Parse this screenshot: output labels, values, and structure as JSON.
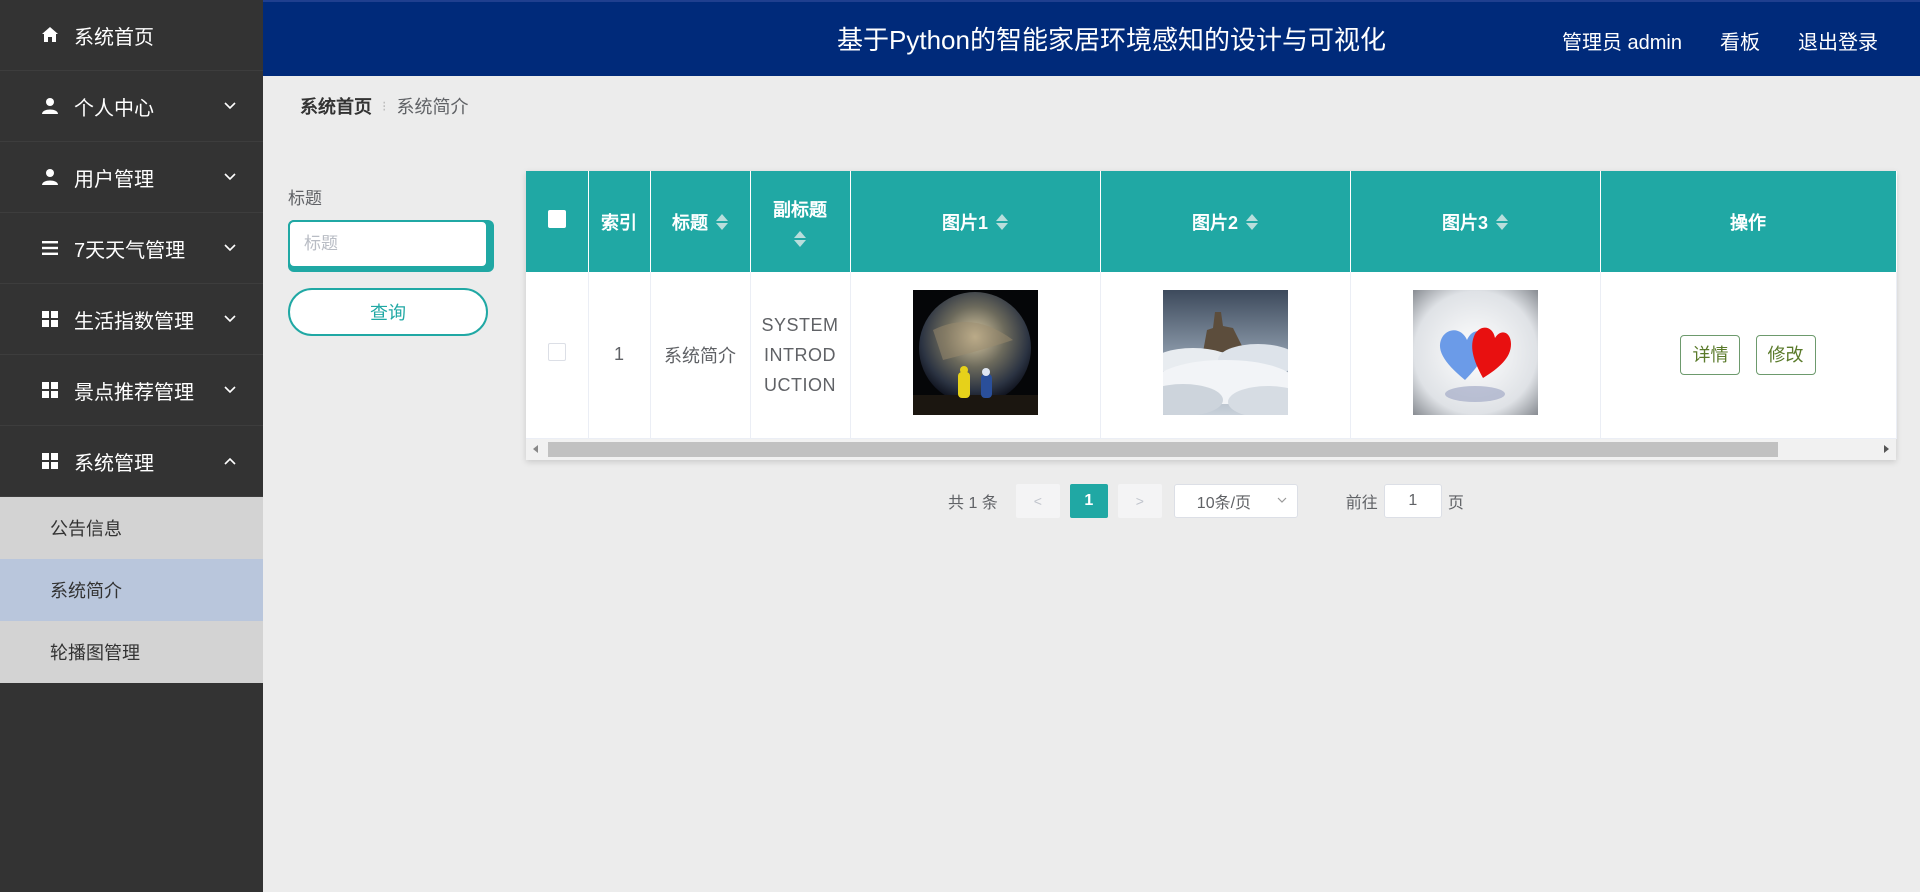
{
  "sidebar": {
    "items": [
      {
        "label": "系统首页",
        "icon": "home-icon"
      },
      {
        "label": "个人中心",
        "icon": "user-icon"
      },
      {
        "label": "用户管理",
        "icon": "user-icon"
      },
      {
        "label": "7天天气管理",
        "icon": "list-icon"
      },
      {
        "label": "生活指数管理",
        "icon": "grid-icon"
      },
      {
        "label": "景点推荐管理",
        "icon": "grid-icon"
      },
      {
        "label": "系统管理",
        "icon": "grid-icon"
      }
    ],
    "submenu": [
      {
        "label": "公告信息"
      },
      {
        "label": "系统简介"
      },
      {
        "label": "轮播图管理"
      }
    ]
  },
  "header": {
    "title": "基于Python的智能家居环境感知的设计与可视化",
    "user": "管理员 admin",
    "board": "看板",
    "logout": "退出登录"
  },
  "breadcrumb": {
    "home": "系统首页",
    "current": "系统简介"
  },
  "search": {
    "label": "标题",
    "placeholder": "标题",
    "button": "查询"
  },
  "table": {
    "columns": [
      "索引",
      "标题",
      "副标题",
      "图片1",
      "图片2",
      "图片3",
      "操作"
    ],
    "rows": [
      {
        "index": "1",
        "title": "系统简介",
        "subtitle": "SYSTEM INTRODUCTION",
        "detail": "详情",
        "edit": "修改"
      }
    ]
  },
  "pagination": {
    "total": "共 1 条",
    "prev": "<",
    "current": "1",
    "next": ">",
    "page_size": "10条/页",
    "goto_label": "前往",
    "goto_value": "1",
    "page_suffix": "页"
  },
  "colors": {
    "accent": "#20a8a4",
    "header_bg": "#002a7a",
    "sidebar_bg": "#333333"
  }
}
